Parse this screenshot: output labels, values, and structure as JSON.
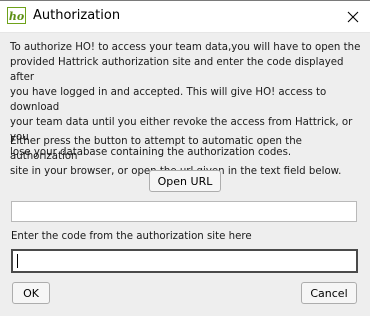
{
  "window": {
    "title": "Authorization",
    "app_icon_text": "ho"
  },
  "content": {
    "intro_text": "To authorize HO! to access your team data,you will have to open the\nprovided Hattrick authorization site and enter the code displayed after\nyou have logged in and accepted. This will give HO! access to download\nyour team data until you either revoke the access from Hattrick, or you\nlose your database containing the authorization codes.",
    "instruction_text": "Either press the button to attempt to automatic open the authorization\nsite in your browser, or open the url given in the text field below.",
    "open_url_label": "Open URL",
    "url_value": "",
    "code_label": "Enter the code from the authorization site here",
    "code_value": ""
  },
  "buttons": {
    "ok_label": "OK",
    "cancel_label": "Cancel"
  },
  "colors": {
    "content_bg": "#eeeeee",
    "icon_green": "#6ea21a"
  },
  "icons": {
    "close": "close-icon",
    "app": "ho-app-icon"
  }
}
